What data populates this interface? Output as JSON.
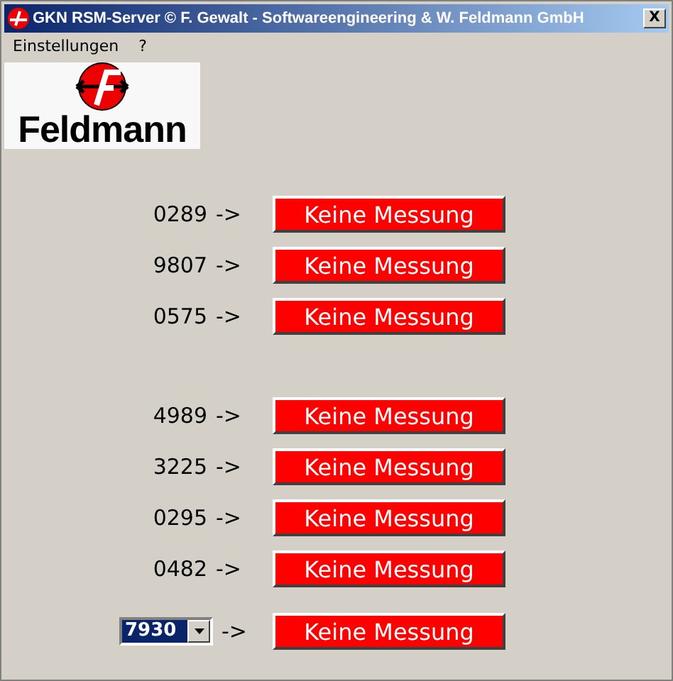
{
  "window": {
    "title": "GKN RSM-Server  © F. Gewalt - Softwareengineering & W. Feldmann GmbH",
    "close": "X"
  },
  "menu": [
    "Einstellungen",
    "?"
  ],
  "logo": {
    "text": "Feldmann"
  },
  "groups": [
    {
      "rows": [
        {
          "kind": "fixed",
          "id": "0289",
          "arrow": "->",
          "status": "Keine Messung"
        },
        {
          "kind": "fixed",
          "id": "9807",
          "arrow": "->",
          "status": "Keine Messung"
        },
        {
          "kind": "fixed",
          "id": "0575",
          "arrow": "->",
          "status": "Keine Messung"
        }
      ]
    },
    {
      "rows": [
        {
          "kind": "fixed",
          "id": "4989",
          "arrow": "->",
          "status": "Keine Messung"
        },
        {
          "kind": "fixed",
          "id": "3225",
          "arrow": "->",
          "status": "Keine Messung"
        },
        {
          "kind": "fixed",
          "id": "0295",
          "arrow": "->",
          "status": "Keine Messung"
        },
        {
          "kind": "fixed",
          "id": "0482",
          "arrow": "->",
          "status": "Keine Messung"
        }
      ]
    },
    {
      "rows": [
        {
          "kind": "select",
          "id": "7930",
          "arrow": "->",
          "status": "Keine Messung"
        }
      ]
    }
  ]
}
